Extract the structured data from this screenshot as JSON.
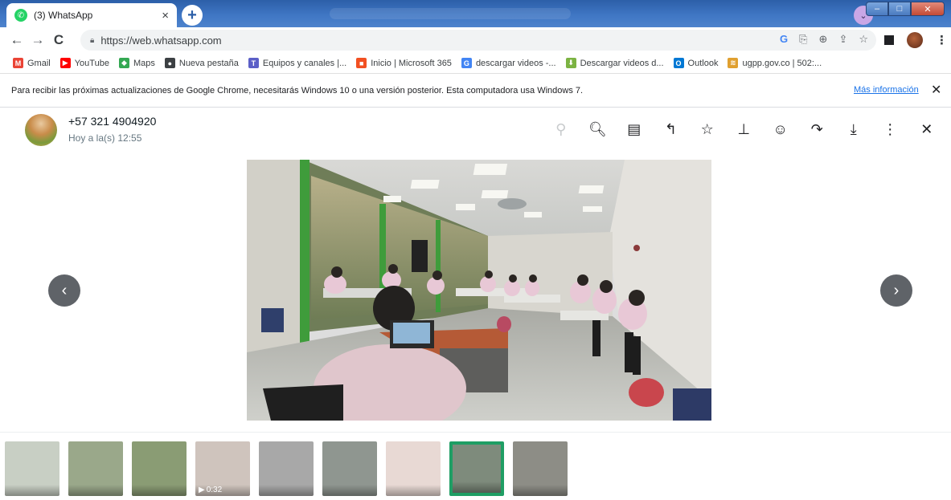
{
  "browser": {
    "tab": {
      "title": "(3) WhatsApp",
      "close": "×"
    },
    "new_tab": "+",
    "url": "https://web.whatsapp.com",
    "nav": {
      "back": "←",
      "forward": "→",
      "reload": "C"
    }
  },
  "bookmarks": [
    {
      "label": "Gmail",
      "icon": "gmail-icon",
      "color": "#ea4335",
      "glyph": "M"
    },
    {
      "label": "YouTube",
      "icon": "youtube-icon",
      "color": "#ff0000",
      "glyph": "▶"
    },
    {
      "label": "Maps",
      "icon": "maps-icon",
      "color": "#34a853",
      "glyph": "◆"
    },
    {
      "label": "Nueva pestaña",
      "icon": "globe-icon",
      "color": "#3c4043",
      "glyph": "●"
    },
    {
      "label": "Equipos y canales |...",
      "icon": "teams-icon",
      "color": "#5b5fc7",
      "glyph": "T"
    },
    {
      "label": "Inicio | Microsoft 365",
      "icon": "microsoft-icon",
      "color": "#f25022",
      "glyph": "■"
    },
    {
      "label": "descargar videos -...",
      "icon": "google-icon",
      "color": "#4285f4",
      "glyph": "G"
    },
    {
      "label": "Descargar videos d...",
      "icon": "download-arrow-icon",
      "color": "#7cb342",
      "glyph": "⬇"
    },
    {
      "label": "Outlook",
      "icon": "outlook-icon",
      "color": "#0078d4",
      "glyph": "O"
    },
    {
      "label": "ugpp.gov.co | 502:...",
      "icon": "ugpp-icon",
      "color": "#e0a030",
      "glyph": "≋"
    }
  ],
  "infobar": {
    "message": "Para recibir las próximas actualizaciones de Google Chrome, necesitarás Windows 10 o una versión posterior. Esta computadora usa Windows 7.",
    "link": "Más información",
    "close": "✕"
  },
  "viewer": {
    "contact_name": "+57 321 4904920",
    "timestamp": "Hoy a la(s) 12:55",
    "actions": [
      {
        "name": "zoom-out-icon",
        "glyph": "⚲",
        "dim": true
      },
      {
        "name": "zoom-in-icon",
        "glyph": "🔍︎",
        "dim": false
      },
      {
        "name": "message-icon",
        "glyph": "▤",
        "dim": false
      },
      {
        "name": "reply-icon",
        "glyph": "↰",
        "dim": false
      },
      {
        "name": "star-icon",
        "glyph": "☆",
        "dim": false
      },
      {
        "name": "pin-icon",
        "glyph": "⊥",
        "dim": false
      },
      {
        "name": "emoji-icon",
        "glyph": "☺",
        "dim": false
      },
      {
        "name": "forward-icon",
        "glyph": "↷",
        "dim": false
      },
      {
        "name": "download-icon",
        "glyph": "⤓",
        "dim": false
      },
      {
        "name": "menu-icon",
        "glyph": "⋮",
        "dim": false
      },
      {
        "name": "close-icon",
        "glyph": "✕",
        "dim": false
      }
    ],
    "prev": "‹",
    "next": "›"
  },
  "thumbnails": [
    {
      "type": "image",
      "active": false,
      "bg": "#c8cfc4"
    },
    {
      "type": "image",
      "active": false,
      "bg": "#9aa88a"
    },
    {
      "type": "image",
      "active": false,
      "bg": "#8a9c74"
    },
    {
      "type": "video",
      "active": false,
      "bg": "#cfc4bd",
      "duration": "0:32"
    },
    {
      "type": "image",
      "active": false,
      "bg": "#a8a8a8"
    },
    {
      "type": "image",
      "active": false,
      "bg": "#8f9690"
    },
    {
      "type": "image",
      "active": false,
      "bg": "#e8d9d4"
    },
    {
      "type": "image",
      "active": true,
      "bg": "#7e8b7c"
    },
    {
      "type": "image",
      "active": false,
      "bg": "#8d8d86"
    }
  ]
}
